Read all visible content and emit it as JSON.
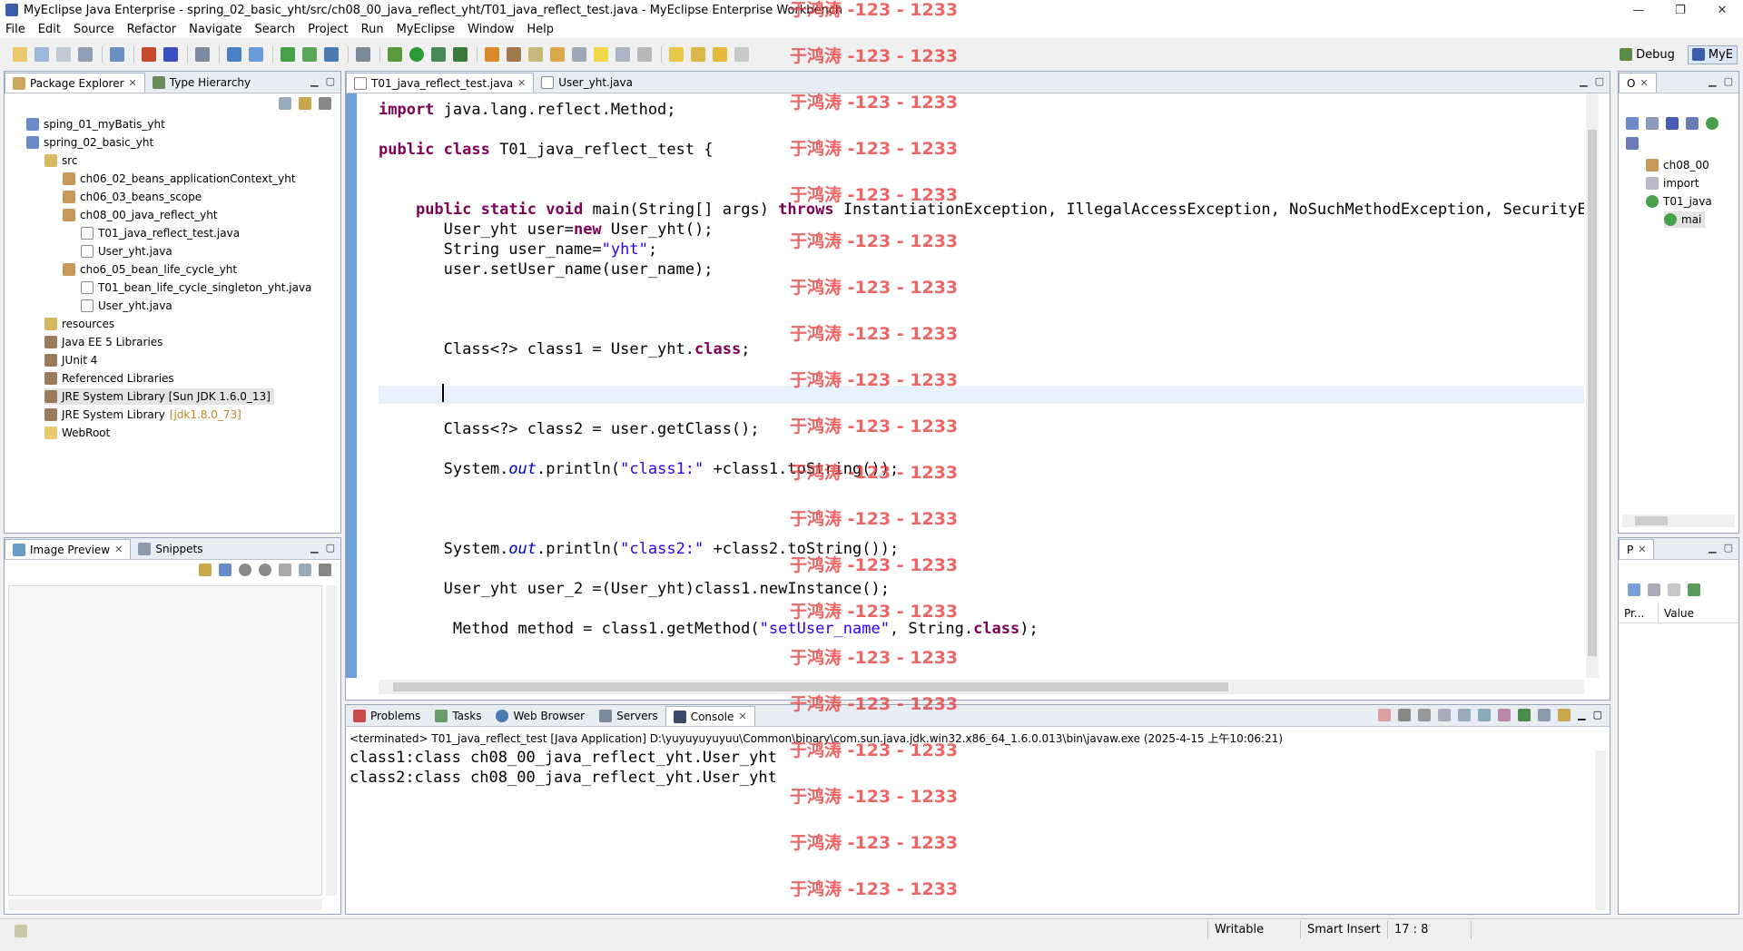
{
  "window": {
    "title": "MyEclipse Java Enterprise - spring_02_basic_yht/src/ch08_00_java_reflect_yht/T01_java_reflect_test.java - MyEclipse Enterprise Workbench",
    "controls": [
      "—",
      "❐",
      "✕"
    ]
  },
  "menu": [
    "File",
    "Edit",
    "Source",
    "Refactor",
    "Navigate",
    "Search",
    "Project",
    "Run",
    "MyEclipse",
    "Window",
    "Help"
  ],
  "perspectives": [
    {
      "label": "Debug",
      "active": false
    },
    {
      "label": "MyE",
      "active": true
    }
  ],
  "package_explorer": {
    "tabs": [
      "Package Explorer",
      "Type Hierarchy"
    ],
    "items": [
      {
        "label": "sping_01_myBatis_yht",
        "icon": "project-icon"
      },
      {
        "label": "spring_02_basic_yht",
        "icon": "project-icon"
      },
      {
        "label": "src",
        "icon": "source-folder-icon"
      },
      {
        "label": "ch06_02_beans_applicationContext_yht",
        "icon": "package-icon"
      },
      {
        "label": "ch06_03_beans_scope",
        "icon": "package-icon"
      },
      {
        "label": "ch08_00_java_reflect_yht",
        "icon": "package-icon"
      },
      {
        "label": "T01_java_reflect_test.java",
        "icon": "java-file-icon"
      },
      {
        "label": "User_yht.java",
        "icon": "java-file-icon"
      },
      {
        "label": "cho6_05_bean_life_cycle_yht",
        "icon": "package-icon"
      },
      {
        "label": "T01_bean_life_cycle_singleton_yht.java",
        "icon": "java-file-icon"
      },
      {
        "label": "User_yht.java",
        "icon": "java-file-icon"
      },
      {
        "label": "resources",
        "icon": "source-folder-icon"
      },
      {
        "label": "Java EE 5 Libraries",
        "icon": "library-icon"
      },
      {
        "label": "JUnit 4",
        "icon": "library-icon"
      },
      {
        "label": "Referenced Libraries",
        "icon": "library-icon"
      },
      {
        "label": "JRE System Library [Sun JDK 1.6.0_13]",
        "icon": "library-icon"
      },
      {
        "label": "JRE System Library",
        "suffix": "[jdk1.8.0_73]",
        "icon": "library-icon"
      },
      {
        "label": "WebRoot",
        "icon": "folder-icon"
      }
    ]
  },
  "image_preview": {
    "tabs": [
      "Image Preview",
      "Snippets"
    ]
  },
  "editor": {
    "tabs": [
      "T01_java_reflect_test.java",
      "User_yht.java"
    ],
    "lines": [
      {
        "indent": "",
        "parts": [
          {
            "t": "import",
            "c": "kw"
          },
          {
            "t": " java.lang.reflect.Method;",
            "c": ""
          }
        ]
      },
      {
        "indent": "",
        "parts": []
      },
      {
        "indent": "",
        "parts": [
          {
            "t": "public",
            "c": "kw"
          },
          {
            "t": " ",
            "c": ""
          },
          {
            "t": "class",
            "c": "kw"
          },
          {
            "t": " T01_java_reflect_test {",
            "c": ""
          }
        ]
      },
      {
        "indent": "",
        "parts": []
      },
      {
        "indent": "",
        "parts": []
      },
      {
        "indent": "    ",
        "parts": [
          {
            "t": "public",
            "c": "kw"
          },
          {
            "t": " ",
            "c": ""
          },
          {
            "t": "static",
            "c": "kw"
          },
          {
            "t": " ",
            "c": ""
          },
          {
            "t": "void",
            "c": "kw"
          },
          {
            "t": " main(String[] args) ",
            "c": ""
          },
          {
            "t": "throws",
            "c": "kw"
          },
          {
            "t": " InstantiationException, IllegalAccessException, NoSuchMethodException, SecurityExce",
            "c": ""
          }
        ]
      },
      {
        "indent": "       ",
        "parts": [
          {
            "t": "User_yht user=",
            "c": ""
          },
          {
            "t": "new",
            "c": "kw"
          },
          {
            "t": " User_yht();",
            "c": ""
          }
        ]
      },
      {
        "indent": "       ",
        "parts": [
          {
            "t": "String user_name=",
            "c": ""
          },
          {
            "t": "\"yht\"",
            "c": "str"
          },
          {
            "t": ";",
            "c": ""
          }
        ]
      },
      {
        "indent": "       ",
        "parts": [
          {
            "t": "user.setUser_name(user_name);",
            "c": ""
          }
        ]
      },
      {
        "indent": "",
        "parts": []
      },
      {
        "indent": "",
        "parts": []
      },
      {
        "indent": "",
        "parts": []
      },
      {
        "indent": "       ",
        "parts": [
          {
            "t": "Class<?> class1 = User_yht.",
            "c": ""
          },
          {
            "t": "class",
            "c": "kw"
          },
          {
            "t": ";",
            "c": ""
          }
        ]
      },
      {
        "indent": "       ",
        "parts": [],
        "current": true
      },
      {
        "indent": "",
        "parts": []
      },
      {
        "indent": "",
        "parts": []
      },
      {
        "indent": "       ",
        "parts": [
          {
            "t": "Class<?> class2 = user.getClass();",
            "c": ""
          }
        ]
      },
      {
        "indent": "",
        "parts": []
      },
      {
        "indent": "       ",
        "parts": [
          {
            "t": "System.",
            "c": ""
          },
          {
            "t": "out",
            "c": "fld"
          },
          {
            "t": ".println(",
            "c": ""
          },
          {
            "t": "\"class1:\"",
            "c": "str"
          },
          {
            "t": " +class1.toString());",
            "c": ""
          }
        ]
      },
      {
        "indent": "",
        "parts": []
      },
      {
        "indent": "",
        "parts": []
      },
      {
        "indent": "",
        "parts": []
      },
      {
        "indent": "       ",
        "parts": [
          {
            "t": "System.",
            "c": ""
          },
          {
            "t": "out",
            "c": "fld"
          },
          {
            "t": ".println(",
            "c": ""
          },
          {
            "t": "\"class2:\"",
            "c": "str"
          },
          {
            "t": " +class2.toString());",
            "c": ""
          }
        ]
      },
      {
        "indent": "",
        "parts": []
      },
      {
        "indent": "       ",
        "parts": [
          {
            "t": "User_yht user_2 =(User_yht)class1.newInstance();",
            "c": ""
          }
        ]
      },
      {
        "indent": "",
        "parts": []
      },
      {
        "indent": "        ",
        "parts": [
          {
            "t": "Method method = class1.getMethod(",
            "c": ""
          },
          {
            "t": "\"setUser_name\"",
            "c": "str"
          },
          {
            "t": ", String.",
            "c": ""
          },
          {
            "t": "class",
            "c": "kw"
          },
          {
            "t": ");",
            "c": ""
          }
        ]
      }
    ]
  },
  "bottom": {
    "tabs": [
      "Problems",
      "Tasks",
      "Web Browser",
      "Servers",
      "Console"
    ],
    "console_header": "<terminated> T01_java_reflect_test [Java Application] D:\\yuyuyuyuyuu\\Common\\binary\\com.sun.java.jdk.win32.x86_64_1.6.0.013\\bin\\javaw.exe (2025-4-15 上午10:06:21)",
    "output": [
      "class1:class ch08_00_java_reflect_yht.User_yht",
      "class2:class ch08_00_java_reflect_yht.User_yht"
    ]
  },
  "outline": {
    "tab": "O",
    "items": [
      "ch08_00",
      "import",
      "T01_java",
      "mai"
    ]
  },
  "properties": {
    "tab": "P",
    "columns": [
      "Pr...",
      "Value"
    ]
  },
  "status": {
    "mode": "Writable",
    "insert": "Smart Insert",
    "position": "17 : 8"
  },
  "watermark": "于鸿涛 -123 - 1233",
  "colors": {
    "keyword": "#7f0055",
    "string": "#2a00ff",
    "field": "#0000c0",
    "watermark": "#e84040"
  }
}
